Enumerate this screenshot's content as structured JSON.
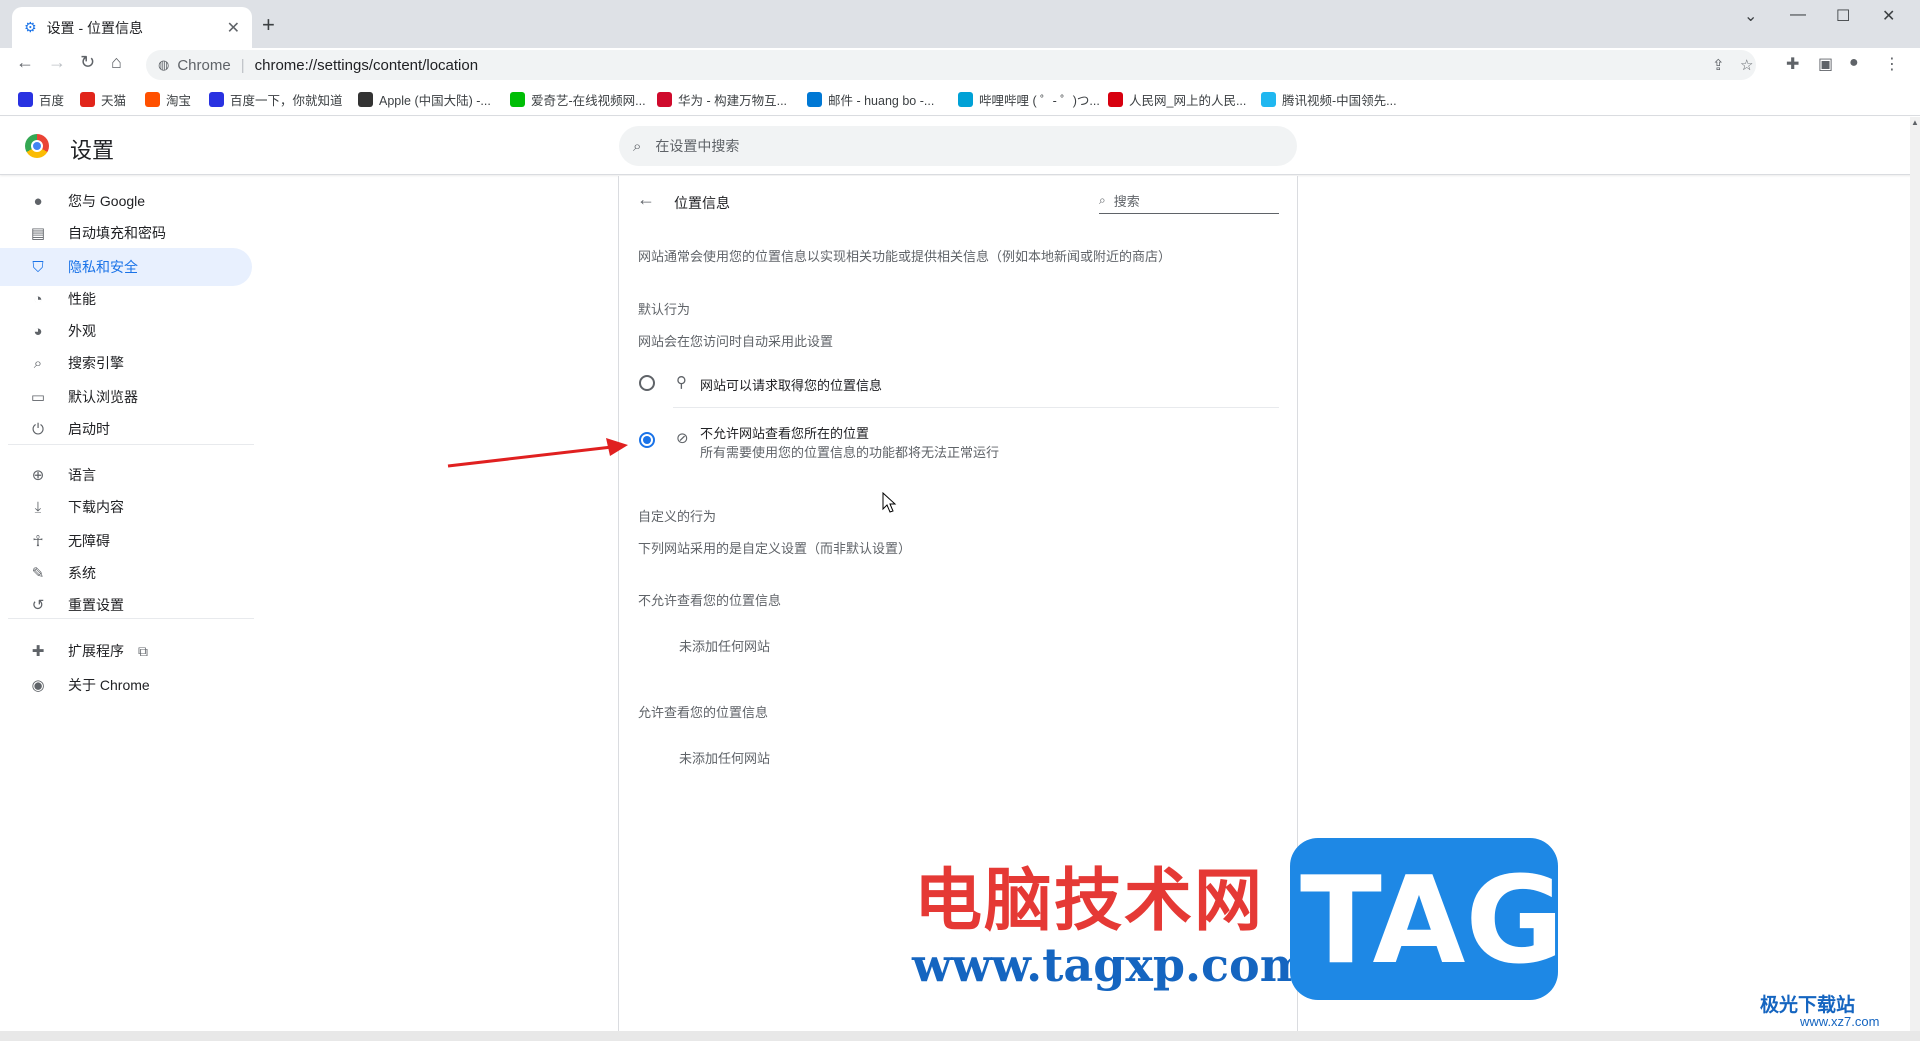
{
  "browser": {
    "tab_title": "设置 - 位置信息",
    "tab_close": "✕",
    "new_tab": "+",
    "window_controls": {
      "chevron": "⌄",
      "minimize": "—",
      "maximize": "☐",
      "close": "✕"
    },
    "omnibox": {
      "site_label": "Chrome",
      "url": "chrome://settings/content/location"
    },
    "bookmarks": [
      {
        "label": "百度",
        "icon": "baidu-icon",
        "color": "#2932e1"
      },
      {
        "label": "天猫",
        "icon": "tmall-icon",
        "color": "#e1251b"
      },
      {
        "label": "淘宝",
        "icon": "taobao-icon",
        "color": "#ff5000"
      },
      {
        "label": "百度一下，你就知道",
        "icon": "baidu-icon",
        "color": "#2932e1"
      },
      {
        "label": "Apple (中国大陆) -...",
        "icon": "apple-icon",
        "color": "#333333"
      },
      {
        "label": "爱奇艺-在线视频网...",
        "icon": "iqiyi-icon",
        "color": "#00be06"
      },
      {
        "label": "华为 - 构建万物互...",
        "icon": "huawei-icon",
        "color": "#cf0a2c"
      },
      {
        "label": "邮件 - huang bo -...",
        "icon": "outlook-icon",
        "color": "#0078d4"
      },
      {
        "label": "哔哩哔哩 ( ゜- ゜)つ...",
        "icon": "bilibili-icon",
        "color": "#00a1d6"
      },
      {
        "label": "人民网_网上的人民...",
        "icon": "people-icon",
        "color": "#d7000f"
      },
      {
        "label": "腾讯视频-中国领先...",
        "icon": "tencent-video-icon",
        "color": "#20b7f0"
      }
    ]
  },
  "settings": {
    "title": "设置",
    "search_placeholder": "在设置中搜索",
    "sidebar": [
      {
        "label": "您与 Google",
        "icon": "person-icon"
      },
      {
        "label": "自动填充和密码",
        "icon": "clipboard-icon"
      },
      {
        "label": "隐私和安全",
        "icon": "shield-icon",
        "active": true
      },
      {
        "label": "性能",
        "icon": "speedometer-icon"
      },
      {
        "label": "外观",
        "icon": "palette-icon"
      },
      {
        "label": "搜索引擎",
        "icon": "search-icon"
      },
      {
        "label": "默认浏览器",
        "icon": "browser-icon"
      },
      {
        "label": "启动时",
        "icon": "power-icon"
      },
      {
        "label": "语言",
        "icon": "globe-icon"
      },
      {
        "label": "下载内容",
        "icon": "download-icon"
      },
      {
        "label": "无障碍",
        "icon": "accessibility-icon"
      },
      {
        "label": "系统",
        "icon": "wrench-icon"
      },
      {
        "label": "重置设置",
        "icon": "history-icon"
      },
      {
        "label": "扩展程序",
        "icon": "puzzle-icon"
      },
      {
        "label": "关于 Chrome",
        "icon": "chrome-icon"
      }
    ],
    "location": {
      "page_title": "位置信息",
      "search_placeholder": "搜索",
      "description": "网站通常会使用您的位置信息以实现相关功能或提供相关信息（例如本地新闻或附近的商店）",
      "default_heading": "默认行为",
      "default_sub": "网站会在您访问时自动采用此设置",
      "option_allow": "网站可以请求取得您的位置信息",
      "option_block": "不允许网站查看您所在的位置",
      "option_block_sub": "所有需要使用您的位置信息的功能都将无法正常运行",
      "selected": "block",
      "custom_heading": "自定义的行为",
      "custom_sub": "下列网站采用的是自定义设置（而非默认设置）",
      "blocked_heading": "不允许查看您的位置信息",
      "blocked_empty": "未添加任何网站",
      "allowed_heading": "允许查看您的位置信息",
      "allowed_empty": "未添加任何网站"
    }
  },
  "watermark": {
    "site_name": "电脑技术网",
    "url": "www.tagxp.com",
    "tag": "TAG",
    "corner_text": "极光下载站",
    "corner_url": "www.xz7.com"
  },
  "colors": {
    "accent": "#1a73e8",
    "arrow": "#e02020"
  }
}
